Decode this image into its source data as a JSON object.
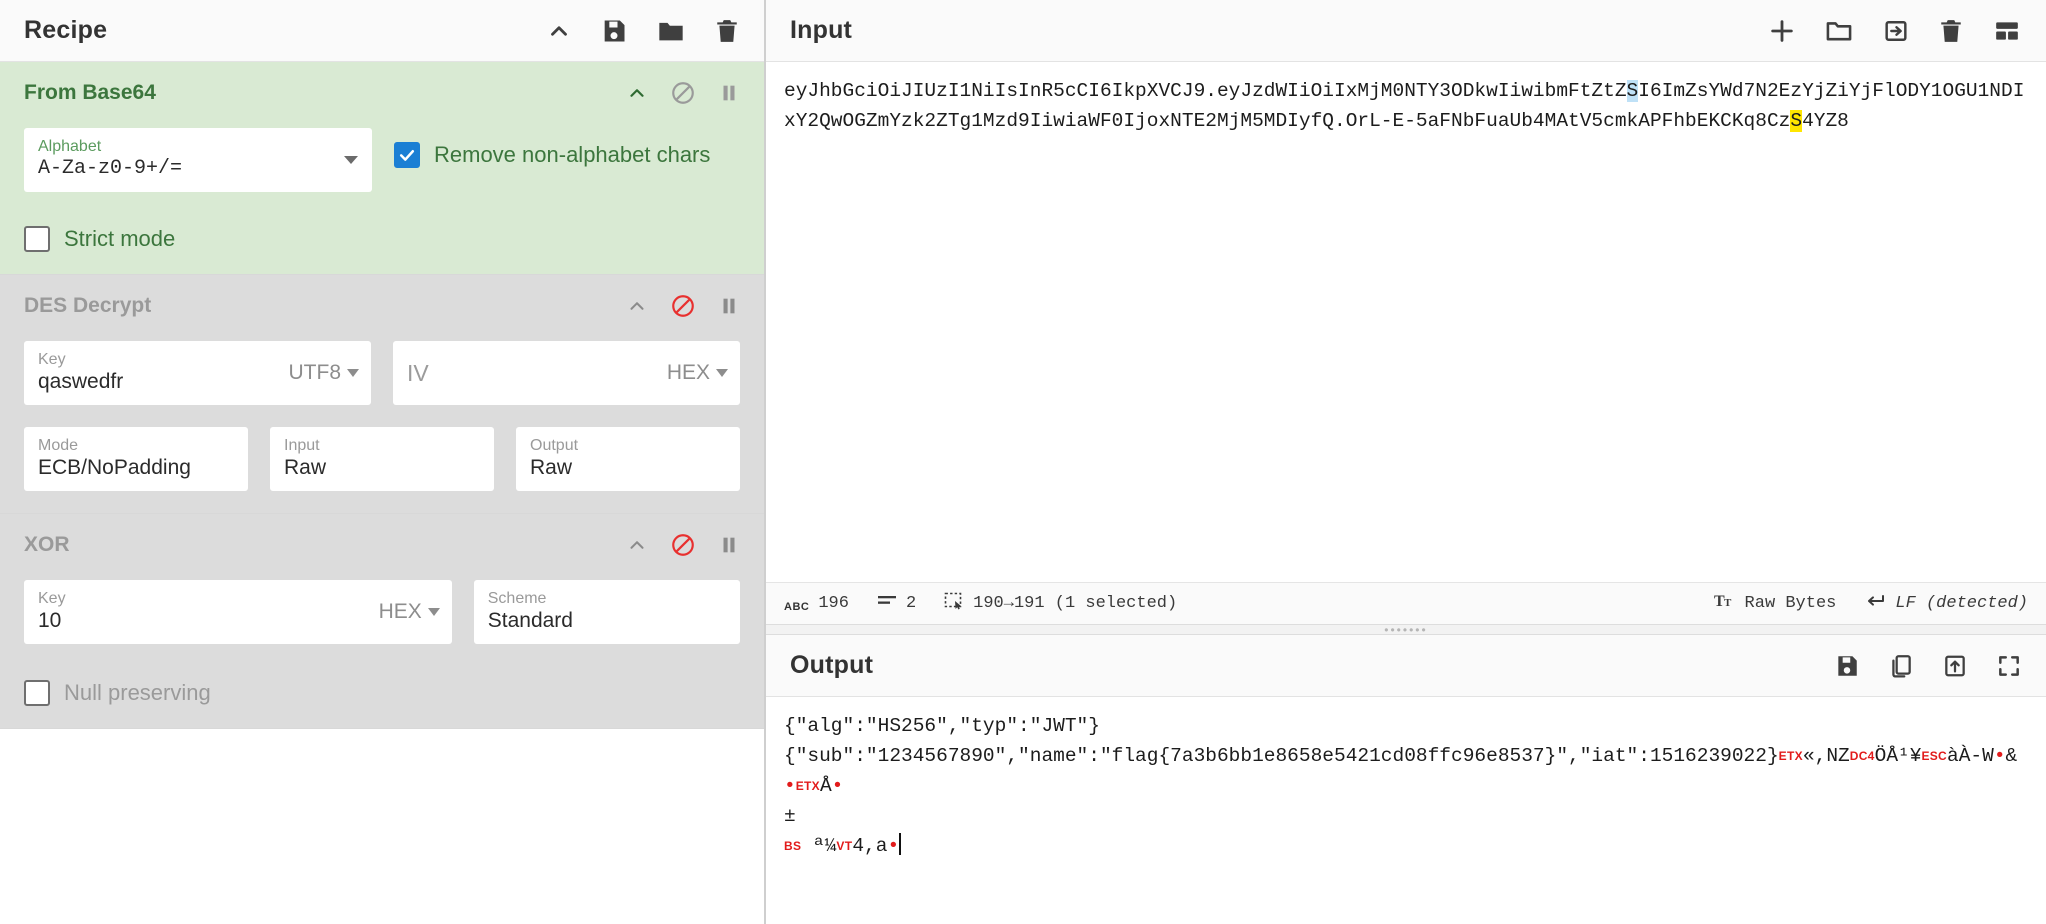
{
  "recipe": {
    "title": "Recipe",
    "header_icons": [
      {
        "name": "collapse-chevron-icon",
        "label": "^"
      },
      {
        "name": "save-recipe-icon",
        "label": "save"
      },
      {
        "name": "load-recipe-icon",
        "label": "folder"
      },
      {
        "name": "clear-recipe-icon",
        "label": "trash"
      }
    ],
    "operations": [
      {
        "name": "From Base64",
        "enabled": true,
        "args": {
          "alphabet_label": "Alphabet",
          "alphabet_value": "A-Za-z0-9+/=",
          "remove_non_alphabet_label": "Remove non-alphabet chars",
          "remove_non_alphabet_checked": true,
          "strict_mode_label": "Strict mode",
          "strict_mode_checked": false
        }
      },
      {
        "name": "DES Decrypt",
        "enabled": false,
        "args": {
          "key_label": "Key",
          "key_value": "qaswedfr",
          "key_unit": "UTF8",
          "iv_label": "IV",
          "iv_value": "",
          "iv_unit": "HEX",
          "mode_label": "Mode",
          "mode_value": "ECB/NoPadding",
          "input_label": "Input",
          "input_value": "Raw",
          "output_label": "Output",
          "output_value": "Raw"
        }
      },
      {
        "name": "XOR",
        "enabled": false,
        "args": {
          "key_label": "Key",
          "key_value": "10",
          "key_unit": "HEX",
          "scheme_label": "Scheme",
          "scheme_value": "Standard",
          "null_preserving_label": "Null preserving",
          "null_preserving_checked": false
        }
      }
    ]
  },
  "input": {
    "title": "Input",
    "header_icons": [
      {
        "name": "add-input-tab-icon",
        "label": "+"
      },
      {
        "name": "open-folder-as-input-icon",
        "label": "folder"
      },
      {
        "name": "open-file-as-input-icon",
        "label": "arrow-into-box"
      },
      {
        "name": "clear-io-icon",
        "label": "trash"
      },
      {
        "name": "reset-pane-layout-icon",
        "label": "layout-grid"
      }
    ],
    "text_part1": "eyJhbGciOiJIUzI1NiIsInR5cCI6IkpXVCJ9.eyJzdWIiOiIxMjM0NTY3ODkwIiwibmFtZtZ",
    "selected_char": "S",
    "text_part2": "I6ImZsYWd7N2EzYjZiYjFlODY1OGU1NDIxY2QwOGZmYzk2ZTg1Mzd9IiwiaWF0IjoxNTE2MjM5MDIyfQ.OrL-E-5aFNbFuaUb4MAtV5cmkAPFhbEKCKq8Cz",
    "highlight_char": "S",
    "text_part3": "4YZ8",
    "status": {
      "length_icon": "abc-length-icon",
      "length": "196",
      "lines_icon": "line-count-icon",
      "lines": "2",
      "selection_icon": "selection-icon",
      "selection": "190→191 (1 selected)",
      "charenc_icon": "character-encoding-icon",
      "charenc": "Raw Bytes",
      "lineend_icon": "line-ending-icon",
      "lineend": "LF (detected)"
    }
  },
  "output": {
    "title": "Output",
    "header_icons": [
      {
        "name": "save-output-icon",
        "label": "save"
      },
      {
        "name": "copy-output-icon",
        "label": "copy"
      },
      {
        "name": "replace-input-with-output-icon",
        "label": "open-in-tab"
      },
      {
        "name": "maximise-output-icon",
        "label": "fullscreen"
      }
    ],
    "line1": "{\"alg\":\"HS256\",\"typ\":\"JWT\"}",
    "line2_text": "{\"sub\":\"1234567890\",\"name\":\"flag{7a3b6bb1e8658e5421cd08ffc96e8537}\",\"iat\":1516239022}",
    "line2_tail": [
      {
        "type": "ctrl",
        "text": "ETX"
      },
      {
        "type": "plain",
        "text": "«,NZ"
      },
      {
        "type": "ctrl",
        "text": "DC4"
      },
      {
        "type": "plain",
        "text": "ÖÅ¹¥"
      },
      {
        "type": "ctrl",
        "text": "ESC"
      },
      {
        "type": "plain",
        "text": "àÀ-W"
      },
      {
        "type": "dot",
        "text": "•"
      },
      {
        "type": "plain",
        "text": "&"
      },
      {
        "type": "dot",
        "text": "•"
      },
      {
        "type": "ctrl",
        "text": "ETX"
      },
      {
        "type": "plain",
        "text": "Å"
      },
      {
        "type": "dot",
        "text": "•"
      }
    ],
    "line3": "±",
    "line4_parts": [
      {
        "type": "ctrl",
        "text": "BS"
      },
      {
        "type": "plain",
        "text": " ª¼"
      },
      {
        "type": "ctrl",
        "text": "VT"
      },
      {
        "type": "plain",
        "text": "4,a"
      },
      {
        "type": "dot",
        "text": "•"
      }
    ]
  },
  "colors": {
    "enabled_op_bg": "#d9ead3",
    "disabled_op_bg": "#dcdcdc",
    "enabled_text": "#3c763d",
    "disabled_text": "#9a9a9a",
    "checkbox_checked": "#1b7fd4",
    "disable_icon_red": "#e8302f",
    "selection_blue": "#bfe1f7",
    "highlight_yellow": "#ffe600",
    "control_char_red": "#e21b1b"
  }
}
